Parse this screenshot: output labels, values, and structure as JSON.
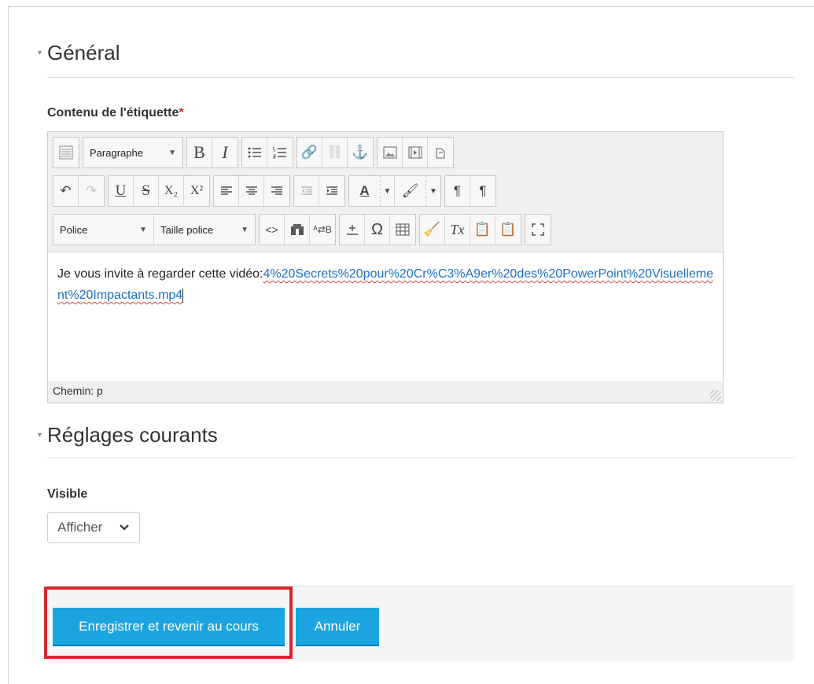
{
  "general": {
    "title": "Général"
  },
  "label_field": {
    "label": "Contenu de l'étiquette",
    "required_mark": "*"
  },
  "editor": {
    "format_select": "Paragraphe",
    "font_select": "Police",
    "size_select": "Taille police",
    "content_text": "Je vous invite à regarder cette vidéo:",
    "content_link": "4%20Secrets%20pour%20Cr%C3%A9er%20des%20PowerPoint%20Visuellement%20Impactants.mp4",
    "status_path": "Chemin: p",
    "bold": "B",
    "italic": "I",
    "underline": "U",
    "strike": "S",
    "subscript": "X₂",
    "superscript": "X²",
    "omega": "Ω"
  },
  "common": {
    "title": "Réglages courants"
  },
  "visible": {
    "label": "Visible",
    "value": "Afficher"
  },
  "actions": {
    "save": "Enregistrer et revenir au cours",
    "cancel": "Annuler"
  },
  "colors": {
    "accent": "#1ba5e0",
    "highlight": "#d9262c",
    "link": "#1a6fc4"
  }
}
